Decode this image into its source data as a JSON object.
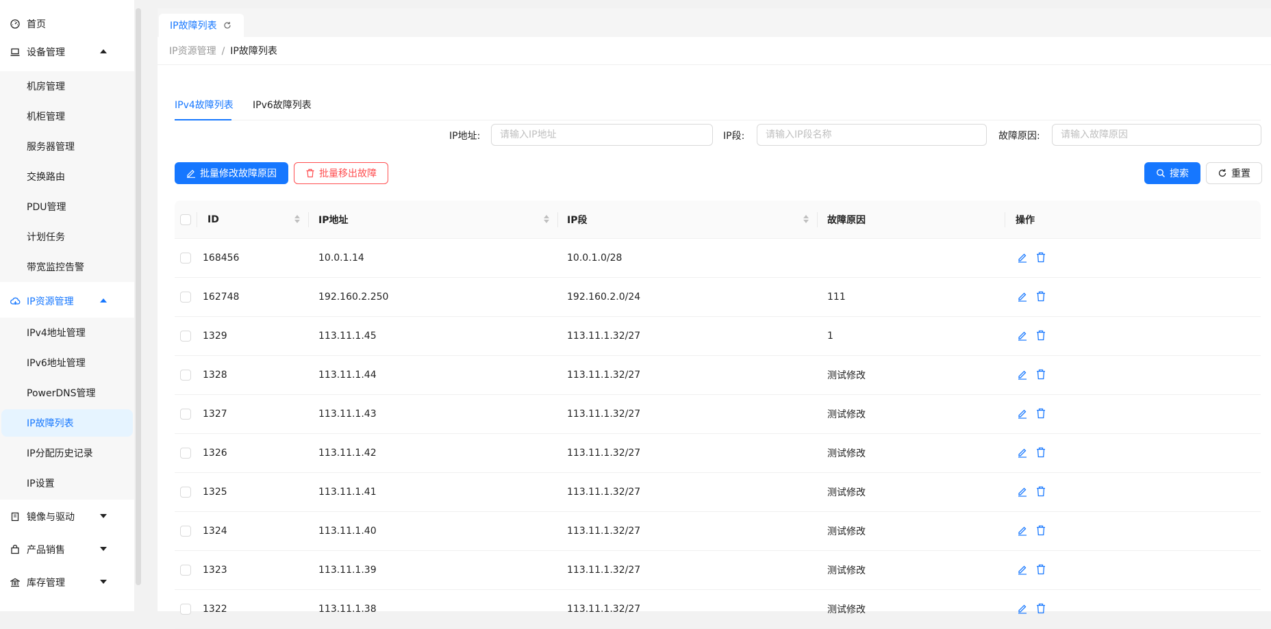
{
  "sidebar": {
    "top_items": [
      {
        "label": "首页",
        "icon": "dashboard-icon"
      },
      {
        "label": "设备管理",
        "icon": "laptop-icon",
        "expanded": true
      },
      {
        "label": "IP资源管理",
        "icon": "cloud-icon",
        "expanded": true,
        "active": true
      },
      {
        "label": "镜像与驱动",
        "icon": "book-icon",
        "expanded": false
      },
      {
        "label": "产品销售",
        "icon": "shopping-bag-icon",
        "expanded": false
      },
      {
        "label": "库存管理",
        "icon": "bank-icon",
        "expanded": false
      }
    ],
    "device_sub": [
      "机房管理",
      "机柜管理",
      "服务器管理",
      "交换路由",
      "PDU管理",
      "计划任务",
      "带宽监控告警"
    ],
    "ip_sub": [
      "IPv4地址管理",
      "IPv6地址管理",
      "PowerDNS管理",
      "IP故障列表",
      "IP分配历史记录",
      "IP设置"
    ],
    "ip_sub_selected": "IP故障列表"
  },
  "page_tab": {
    "label": "IP故障列表"
  },
  "breadcrumb": {
    "parent": "IP资源管理",
    "separator": "/",
    "current": "IP故障列表"
  },
  "tabs": [
    {
      "label": "IPv4故障列表",
      "active": true
    },
    {
      "label": "IPv6故障列表",
      "active": false
    }
  ],
  "filters": {
    "ip": {
      "label": "IP地址:",
      "placeholder": "请输入IP地址",
      "value": ""
    },
    "segment": {
      "label": "IP段:",
      "placeholder": "请输入IP段名称",
      "value": ""
    },
    "reason": {
      "label": "故障原因:",
      "placeholder": "请输入故障原因",
      "value": ""
    }
  },
  "toolbar": {
    "batch_edit_label": "批量修改故障原因",
    "batch_remove_label": "批量移出故障",
    "search_label": "搜索",
    "reset_label": "重置"
  },
  "table": {
    "columns": [
      "ID",
      "IP地址",
      "IP段",
      "故障原因",
      "操作"
    ],
    "rows": [
      {
        "id": "168456",
        "ip": "10.0.1.14",
        "segment": "10.0.1.0/28",
        "reason": ""
      },
      {
        "id": "162748",
        "ip": "192.160.2.250",
        "segment": "192.160.2.0/24",
        "reason": "111"
      },
      {
        "id": "1329",
        "ip": "113.11.1.45",
        "segment": "113.11.1.32/27",
        "reason": "1"
      },
      {
        "id": "1328",
        "ip": "113.11.1.44",
        "segment": "113.11.1.32/27",
        "reason": "测试修改"
      },
      {
        "id": "1327",
        "ip": "113.11.1.43",
        "segment": "113.11.1.32/27",
        "reason": "测试修改"
      },
      {
        "id": "1326",
        "ip": "113.11.1.42",
        "segment": "113.11.1.32/27",
        "reason": "测试修改"
      },
      {
        "id": "1325",
        "ip": "113.11.1.41",
        "segment": "113.11.1.32/27",
        "reason": "测试修改"
      },
      {
        "id": "1324",
        "ip": "113.11.1.40",
        "segment": "113.11.1.32/27",
        "reason": "测试修改"
      },
      {
        "id": "1323",
        "ip": "113.11.1.39",
        "segment": "113.11.1.32/27",
        "reason": "测试修改"
      },
      {
        "id": "1322",
        "ip": "113.11.1.38",
        "segment": "113.11.1.32/27",
        "reason": "测试修改"
      }
    ]
  },
  "colors": {
    "primary": "#1677ff",
    "danger": "#ff4d4f",
    "selected_bg": "#e6f4ff"
  }
}
